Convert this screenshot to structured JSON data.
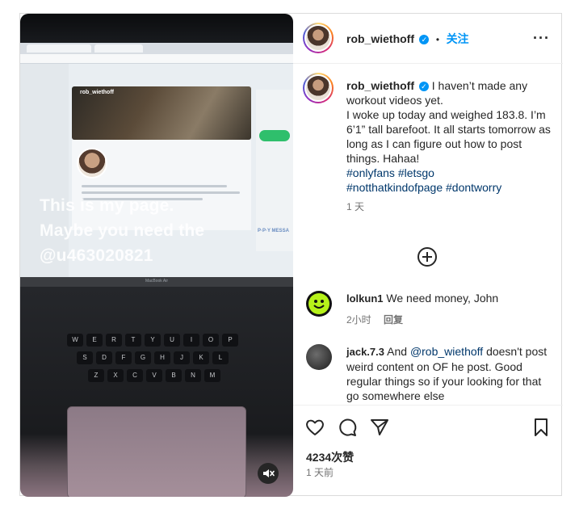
{
  "media": {
    "overlay_line1": "This is my page.",
    "overlay_line2": "Maybe you need the",
    "overlay_line3": "@u463020821",
    "screen_banner_name": "rob_wiethoff",
    "screen_msg_label": "P·P·Y MESSA",
    "screen_hinge_label": "MacBook Air",
    "keyboard_row1": [
      "W",
      "E",
      "R",
      "T",
      "Y",
      "U",
      "I",
      "O",
      "P"
    ],
    "keyboard_row2": [
      "S",
      "D",
      "F",
      "G",
      "H",
      "J",
      "K",
      "L"
    ],
    "keyboard_row3": [
      "Z",
      "X",
      "C",
      "V",
      "B",
      "N",
      "M"
    ],
    "mute_icon": "speaker-muted-icon"
  },
  "header": {
    "username": "rob_wiethoff",
    "separator": "•",
    "follow_label": "关注",
    "more_label": "···"
  },
  "caption": {
    "username": "rob_wiethoff",
    "line1": "I haven’t made any workout videos yet.",
    "line2": "I woke up today and weighed 183.8. I’m 6’1” tall barefoot. It all starts tomorrow as long as I can figure out how to post things. Hahaa!",
    "tag1": "#onlyfans",
    "tag2": "#letsgo",
    "tag3": "#notthatkindofpage",
    "tag4": "#dontworry",
    "time": "1 天"
  },
  "comments": [
    {
      "username": "lolkun1",
      "text": "We need money, John",
      "time": "2小时",
      "reply_label": "回复"
    },
    {
      "username": "jack.7.3",
      "text_before": "And",
      "mention": "@rob_wiethoff",
      "text_after": "doesn't post weird content on OF he post. Good regular things so if your looking for that go somewhere else"
    }
  ],
  "footer": {
    "likes": "4234次赞",
    "posted": "1 天前"
  },
  "icons": {
    "like": "heart-icon",
    "comment": "comment-icon",
    "share": "paper-plane-icon",
    "save": "bookmark-icon",
    "add_comment": "plus-circle-icon",
    "verified": "verified-badge-icon"
  },
  "colors": {
    "accent": "#0095f6",
    "hashtag": "#00376b",
    "muted_text": "#737373"
  }
}
